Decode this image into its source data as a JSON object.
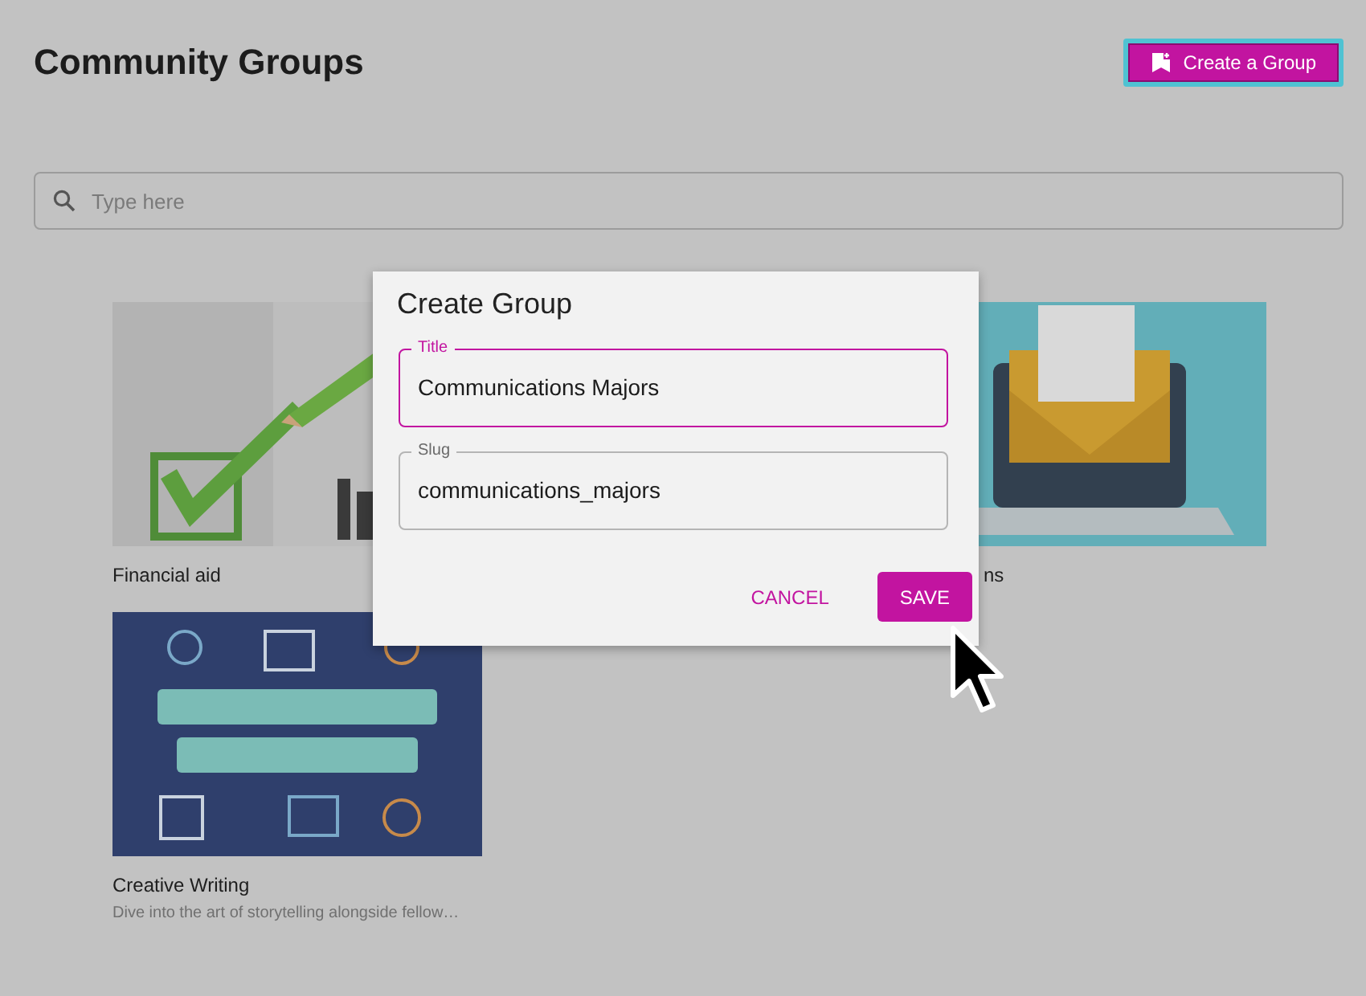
{
  "header": {
    "title": "Community Groups",
    "create_button": {
      "label": "Create a Group",
      "focused": true
    }
  },
  "search": {
    "placeholder": "Type here"
  },
  "groups": [
    {
      "title": "Financial aid"
    },
    {
      "title": "ns",
      "cut": true
    },
    {
      "title": "Creative Writing",
      "description": "Dive into the art of storytelling alongside fellow…"
    }
  ],
  "dialog": {
    "title": "Create Group",
    "fields": [
      {
        "label": "Title",
        "value": "Communications Majors",
        "focused": true
      },
      {
        "label": "Slug",
        "value": "communications_majors",
        "focused": false
      }
    ],
    "buttons": [
      {
        "label": "CANCEL",
        "kind": "text"
      },
      {
        "label": "SAVE",
        "kind": "contained"
      }
    ]
  }
}
